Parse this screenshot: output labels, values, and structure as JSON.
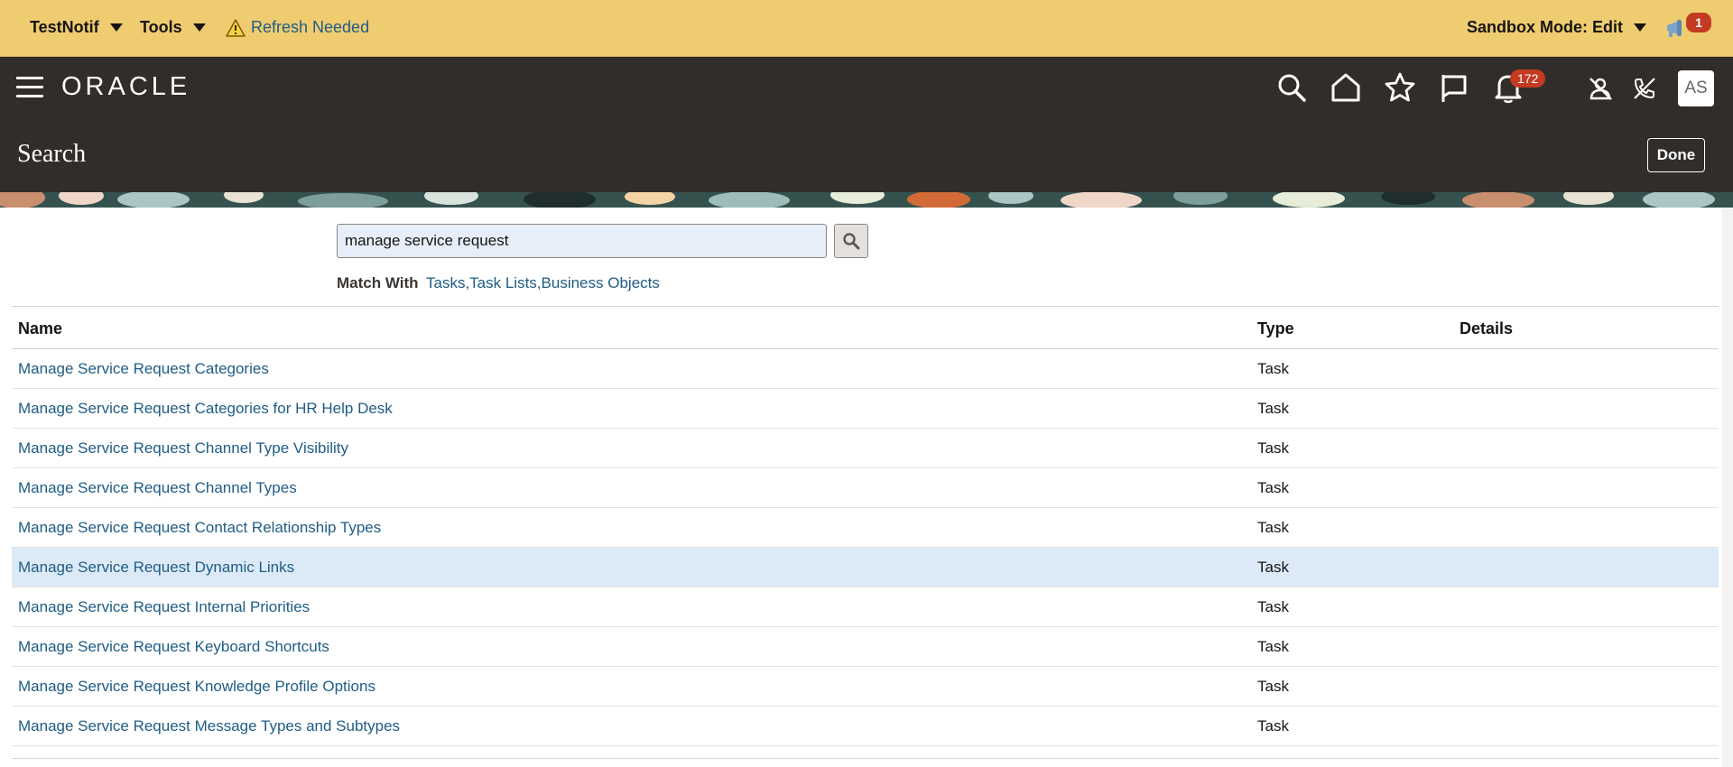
{
  "sandbox_bar": {
    "menu_testnotif": "TestNotif",
    "menu_tools": "Tools",
    "refresh_text": "Refresh Needed",
    "sandbox_mode": "Sandbox Mode: Edit",
    "announcement_count": "1",
    "bg_color": "#f0cc71"
  },
  "header": {
    "logo": "ORACLE",
    "notification_count": "172",
    "avatar_initials": "AS",
    "page_title": "Search",
    "done_label": "Done",
    "bg_color": "#312d2a",
    "icons": [
      "menu-icon",
      "search-icon",
      "home-icon",
      "favorites-star-icon",
      "flag-icon",
      "bell-icon",
      "no-user-icon",
      "no-phone-icon"
    ]
  },
  "search": {
    "value": "manage service request",
    "match_with_label": "Match With",
    "match_with_value": "Tasks,Task Lists,Business Objects"
  },
  "table": {
    "columns": [
      "Name",
      "Type",
      "Details"
    ],
    "rows": [
      {
        "name": "Manage Service Request Categories",
        "type": "Task",
        "details": ""
      },
      {
        "name": "Manage Service Request Categories for HR Help Desk",
        "type": "Task",
        "details": ""
      },
      {
        "name": "Manage Service Request Channel Type Visibility",
        "type": "Task",
        "details": ""
      },
      {
        "name": "Manage Service Request Channel Types",
        "type": "Task",
        "details": ""
      },
      {
        "name": "Manage Service Request Contact Relationship Types",
        "type": "Task",
        "details": ""
      },
      {
        "name": "Manage Service Request Dynamic Links",
        "type": "Task",
        "details": "",
        "selected": true
      },
      {
        "name": "Manage Service Request Internal Priorities",
        "type": "Task",
        "details": ""
      },
      {
        "name": "Manage Service Request Keyboard Shortcuts",
        "type": "Task",
        "details": ""
      },
      {
        "name": "Manage Service Request Knowledge Profile Options",
        "type": "Task",
        "details": ""
      },
      {
        "name": "Manage Service Request Message Types and Subtypes",
        "type": "Task",
        "details": ""
      }
    ],
    "link_color": "#1f5c85",
    "selected_row_color": "#dceaf8"
  }
}
